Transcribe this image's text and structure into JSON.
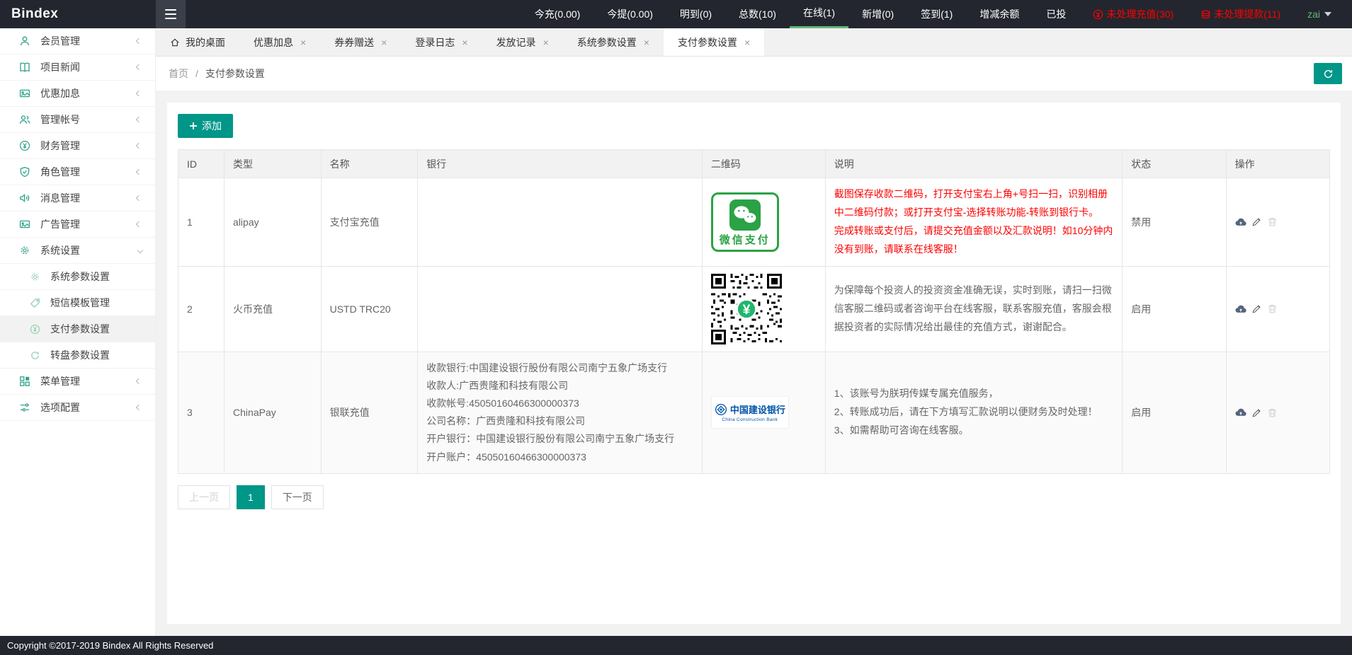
{
  "navbar": {
    "brand": "Bindex",
    "stats": [
      {
        "label": "今充(0.00)"
      },
      {
        "label": "今提(0.00)"
      },
      {
        "label": "明到(0)"
      },
      {
        "label": "总数(10)"
      },
      {
        "label": "在线(1)",
        "active": true
      },
      {
        "label": "新增(0)"
      },
      {
        "label": "签到(1)"
      },
      {
        "label": "增减余额"
      },
      {
        "label": "已投"
      }
    ],
    "alerts": [
      {
        "label": "未处理充值(30)",
        "icon": "recharge-alert-icon",
        "color": "#FF0000"
      },
      {
        "label": "未处理提款(11)",
        "icon": "withdraw-alert-icon",
        "color": "#FF0000"
      }
    ],
    "username": "zai",
    "active_underline_color": "#5FB878"
  },
  "sidebar": {
    "items": [
      {
        "label": "会员管理",
        "icon": "user-icon"
      },
      {
        "label": "项目新闻",
        "icon": "book-icon"
      },
      {
        "label": "优惠加息",
        "icon": "promo-icon"
      },
      {
        "label": "管理帐号",
        "icon": "accounts-icon"
      },
      {
        "label": "财务管理",
        "icon": "yen-circle-icon"
      },
      {
        "label": "角色管理",
        "icon": "shield-check-icon"
      },
      {
        "label": "消息管理",
        "icon": "speaker-icon"
      },
      {
        "label": "广告管理",
        "icon": "picture-icon"
      },
      {
        "label": "系统设置",
        "icon": "gear-icon",
        "expanded": true,
        "children": [
          {
            "label": "系统参数设置",
            "icon": "gear-icon"
          },
          {
            "label": "短信模板管理",
            "icon": "tag-icon"
          },
          {
            "label": "支付参数设置",
            "icon": "yen-circle-icon",
            "active": true
          },
          {
            "label": "转盘参数设置",
            "icon": "wheel-icon"
          }
        ]
      },
      {
        "label": "菜单管理",
        "icon": "grid-icon"
      },
      {
        "label": "选项配置",
        "icon": "tools-icon"
      }
    ]
  },
  "tabs": [
    {
      "label": "我的桌面",
      "closable": false,
      "icon": "home-icon"
    },
    {
      "label": "优惠加息",
      "closable": true
    },
    {
      "label": "券券赠送",
      "closable": true
    },
    {
      "label": "登录日志",
      "closable": true
    },
    {
      "label": "发放记录",
      "closable": true
    },
    {
      "label": "系统参数设置",
      "closable": true
    },
    {
      "label": "支付参数设置",
      "closable": true,
      "active": true
    }
  ],
  "breadcrumb": {
    "home": "首页",
    "separator": "/",
    "current": "支付参数设置"
  },
  "toolbar": {
    "add_label": "添加",
    "accent_color": "#009688"
  },
  "table": {
    "columns": [
      "ID",
      "类型",
      "名称",
      "银行",
      "二维码",
      "说明",
      "状态",
      "操作"
    ],
    "rows": [
      {
        "id": "1",
        "type": "alipay",
        "name": "支付宝充值",
        "bank_lines": [],
        "qr_kind": "wechat-pay-logo",
        "qr_caption": "微信支付",
        "desc_lines": [
          "截图保存收款二维码，打开支付宝右上角+号扫一扫，识别相册中二维码付款；或打开支付宝-选择转账功能-转账到银行卡。",
          "完成转账或支付后，请提交充值金额以及汇款说明！如10分钟内没有到账，请联系在线客服！"
        ],
        "desc_color": "#FF0000",
        "status": "禁用"
      },
      {
        "id": "2",
        "type": "火币充值",
        "name": "USTD TRC20",
        "bank_lines": [],
        "qr_kind": "qr-code",
        "qr_center_symbol": "¥",
        "desc_lines": [
          "为保障每个投资人的投资资金准确无误，实时到账，请扫一扫微信客服二维码或者咨询平台在线客服，联系客服充值，客服会根据投资者的实际情况给出最佳的充值方式，谢谢配合。"
        ],
        "desc_color": "#666666",
        "status": "启用"
      },
      {
        "id": "3",
        "type": "ChinaPay",
        "name": "银联充值",
        "bank_lines": [
          "收款银行:中国建设银行股份有限公司南宁五象广场支行",
          "收款人:广西贵隆和科技有限公司",
          "收款帐号:45050160466300000373",
          "公司名称：广西贵隆和科技有限公司",
          "开户银行：中国建设银行股份有限公司南宁五象广场支行",
          "开户账户：45050160466300000373"
        ],
        "qr_kind": "ccb-logo",
        "qr_caption": "中国建设银行",
        "qr_subcaption": "China Construction Bank",
        "desc_lines": [
          "1、该账号为朕玥传媒专属充值服务，",
          "2、转账成功后，请在下方填写汇款说明以便财务及时处理！",
          "3、如需帮助可咨询在线客服。"
        ],
        "desc_color": "#666666",
        "status": "启用"
      }
    ],
    "row_actions": [
      "cloud-upload",
      "edit",
      "delete"
    ]
  },
  "pagination": {
    "prev": "上一页",
    "current": "1",
    "next": "下一页"
  },
  "footer": {
    "copyright": "Copyright ©2017-2019 Bindex All Rights Reserved"
  }
}
